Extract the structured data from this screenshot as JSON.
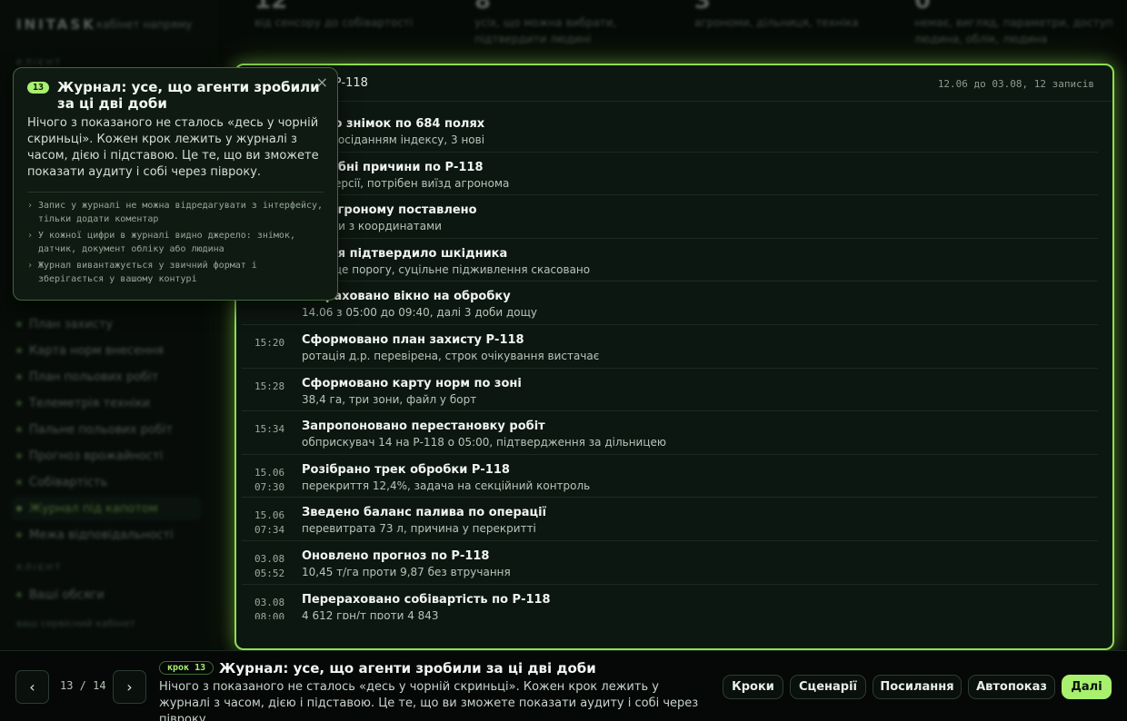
{
  "app": {
    "brand": "INITASK",
    "subtitle": "кабінет напряму"
  },
  "sidebar": {
    "section_top": "КЛІЄНТ",
    "items": [
      {
        "label": "План захисту"
      },
      {
        "label": "Карта норм внесення"
      },
      {
        "label": "План польових робіт"
      },
      {
        "label": "Телеметрія техніки"
      },
      {
        "label": "Пальне польових робіт"
      },
      {
        "label": "Прогноз врожайності"
      },
      {
        "label": "Собівартість"
      },
      {
        "label": "Журнал під капотом",
        "active": true
      },
      {
        "label": "Межа відповідальності"
      }
    ],
    "section_bottom": "КЛІЄНТ",
    "bottom_items": [
      {
        "label": "Ваші обсяги"
      }
    ],
    "footer": "ваш сервісний кабінет"
  },
  "stats": [
    {
      "num": "12",
      "caption": "від сенсору до собівартості"
    },
    {
      "num": "8",
      "caption": "усіх, що можна вибрати, підтвердити людині"
    },
    {
      "num": "3",
      "caption": "агрономи, дільниця, техніка"
    },
    {
      "num": "0",
      "caption": "немає, вигляд, параметри, доступ людина, облік, людина"
    }
  ],
  "journal": {
    "title": "дій по полю Р-118",
    "range": "12.06 до 03.08, 12 записів",
    "entries": [
      {
        "time1": "",
        "time2": "",
        "title": "влено знімок по 684 полях",
        "desc": "в із просіданням індексу, 3 нові"
      },
      {
        "time1": "",
        "time2": "",
        "title": "но хибні причини по Р-118",
        "desc": "сь 2 версії, потрібен виїзд агронома"
      },
      {
        "time1": "",
        "time2": "",
        "title": "ння агроному поставлено",
        "desc": "4 точки з координатами"
      },
      {
        "time1": "",
        "time2": "",
        "title": "ження підтвердило шкідника",
        "desc": "ть вище порогу, суцільне підживлення скасовано"
      },
      {
        "time1": "",
        "time2": "",
        "title": "Розраховано вікно на обробку",
        "desc": "14.06 з 05:00 до 09:40, далі 3 доби дощу"
      },
      {
        "time1": "15:20",
        "time2": "",
        "title": "Сформовано план захисту Р-118",
        "desc": "ротація д.р. перевірена, строк очікування вистачає"
      },
      {
        "time1": "15:28",
        "time2": "",
        "title": "Сформовано карту норм по зоні",
        "desc": "38,4 га, три зони, файл у борт"
      },
      {
        "time1": "15:34",
        "time2": "",
        "title": "Запропоновано перестановку робіт",
        "desc": "обприскувач 14 на Р-118 о 05:00, підтвердження за дільницею"
      },
      {
        "time1": "15.06",
        "time2": "07:30",
        "title": "Розібрано трек обробки Р-118",
        "desc": "перекриття 12,4%, задача на секційний контроль"
      },
      {
        "time1": "15.06",
        "time2": "07:34",
        "title": "Зведено баланс палива по операції",
        "desc": "перевитрата 73 л, причина у перекритті"
      },
      {
        "time1": "03.08",
        "time2": "05:52",
        "title": "Оновлено прогноз по Р-118",
        "desc": "10,45 т/га проти 9,87 без втручання"
      },
      {
        "time1": "03.08",
        "time2": "08:00",
        "title": "Перераховано собівартість по Р-118",
        "desc": "4 612 грн/т проти 4 843"
      }
    ]
  },
  "tooltip": {
    "badge": "13",
    "title": "Журнал: усе, що агенти зробили за ці дві доби",
    "body": "Нічого з показаного не сталось «десь у чорній скриньці». Кожен крок лежить у журналі з часом, дією і підставою. Це те, що ви зможете показати аудиту і собі через півроку.",
    "points": [
      "Запис у журналі не можна відредагувати з інтерфейсу, тільки додати коментар",
      "У кожної цифри в журналі видно джерело: знімок, датчик, документ обліку або людина",
      "Журнал вивантажується у звичний формат і зберігається у вашому контурі"
    ],
    "close": "×"
  },
  "tour": {
    "prev": "‹",
    "next": "›",
    "counter": "13 / 14",
    "step_label": "крок 13",
    "title": "Журнал: усе, що агенти зробили за ці дві доби",
    "desc": "Нічого з показаного не сталось «десь у чорній скриньці». Кожен крок лежить у журналі з часом, дією і підставою. Це те, що ви зможете показати аудиту і собі через півроку.",
    "buttons": {
      "steps": "Кроки",
      "scenarios": "Сценарії",
      "links": "Посилання",
      "autoplay": "Автопоказ",
      "next": "Далі"
    }
  },
  "colors": {
    "accent": "#a8f06e",
    "glow": "#8ee04f",
    "bg": "#060a07",
    "panel": "#0d1711"
  }
}
